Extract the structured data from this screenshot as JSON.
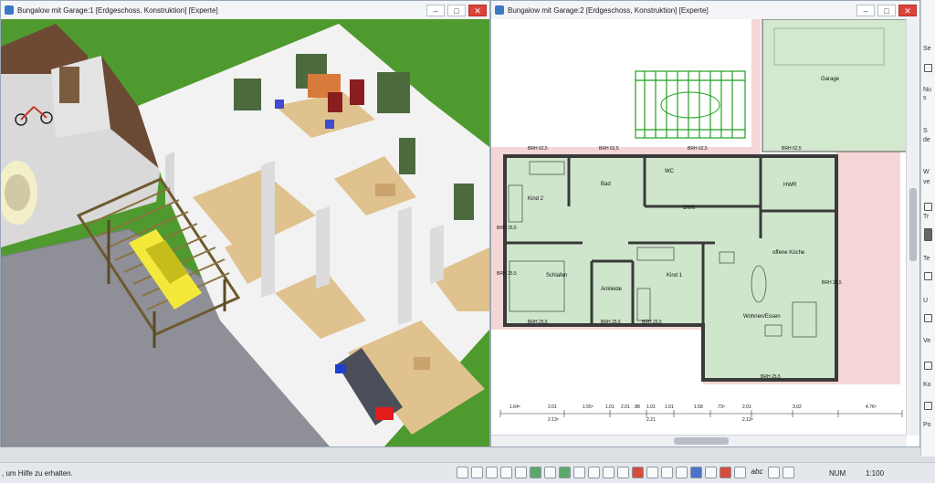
{
  "windows": {
    "view3d": {
      "title": "Bungalow mit Garage:1 [Erdgeschoss, Konstruktion] [Experte]"
    },
    "plan2d": {
      "title": "Bungalow mit Garage:2 [Erdgeschoss, Konstruktion] [Experte]"
    }
  },
  "window_controls": {
    "minimize": "–",
    "maximize": "□",
    "close": "✕"
  },
  "rooms": {
    "garage": "Garage",
    "kind2": "Kind 2",
    "bad": "Bad",
    "wc": "WC",
    "hwr": "HWR",
    "diele": "Diele",
    "schlafen": "Schlafen",
    "ankleide": "Ankleide",
    "kind1": "Kind 1",
    "kueche": "offene Küche",
    "wohnen": "Wohnen/Essen"
  },
  "brh_labels": [
    "BRH 62,5",
    "BRH 62,5",
    "BRH 62,5",
    "BRH 62,5",
    "BRH 25,5",
    "BRH 25,5",
    "BRH 25,5",
    "BRH 25,5",
    "BRH 25,5",
    "BRH 25,5",
    "BRH 25,5"
  ],
  "dimensions": [
    "1.64⁵",
    "2.01",
    "2.13⁵",
    "1.55⁵",
    "1.01",
    "2.01",
    ".88",
    "1.01",
    "2.21",
    "1.01",
    "1.58",
    ".73⁵",
    "2.01",
    "2.13⁵",
    "3.02",
    "4.76⁵"
  ],
  "right_panel": [
    "Se",
    "Nu",
    "s",
    "S",
    "de",
    "W",
    "ve",
    "Tr",
    "Te",
    "U",
    "Ve",
    "Ko",
    "Po"
  ],
  "status": {
    "help_text": ", um Hilfe zu erhalten.",
    "abc_label": "abc",
    "num": "NUM",
    "scale": "1:100"
  }
}
